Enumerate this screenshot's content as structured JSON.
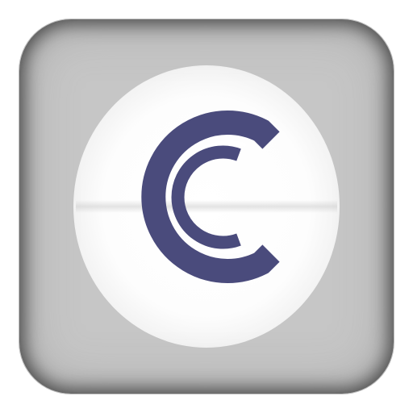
{
  "icon": {
    "name": "c-logo-app-icon",
    "colors": {
      "logo": "#4a4b7c",
      "tile": "#c6c6c6",
      "glow": "#ffffff"
    }
  }
}
